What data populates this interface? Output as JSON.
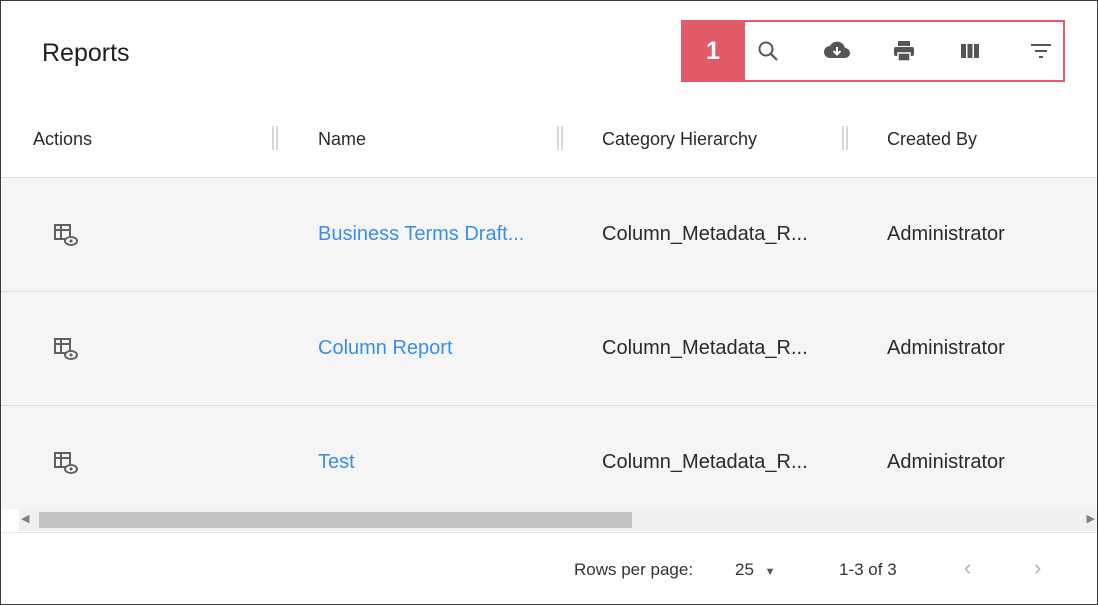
{
  "page": {
    "title": "Reports"
  },
  "toolbar": {
    "badge": "1",
    "icons": [
      "search-icon",
      "download-icon",
      "print-icon",
      "view-columns-icon",
      "filter-icon"
    ],
    "highlight_color": "#e05a68"
  },
  "table": {
    "columns": [
      "Actions",
      "Name",
      "Category Hierarchy",
      "Created By"
    ],
    "rows": [
      {
        "name": "Business Terms Draft...",
        "category": "Column_Metadata_R...",
        "created_by": "Administrator"
      },
      {
        "name": "Column Report",
        "category": "Column_Metadata_R...",
        "created_by": "Administrator"
      },
      {
        "name": "Test",
        "category": "Column_Metadata_R...",
        "created_by": "Administrator"
      }
    ],
    "link_color": "#3a8ee6"
  },
  "pagination": {
    "rows_per_page_label": "Rows per page:",
    "rows_per_page_value": "25",
    "range": "1-3 of 3",
    "prev": "‹",
    "next": "›"
  }
}
